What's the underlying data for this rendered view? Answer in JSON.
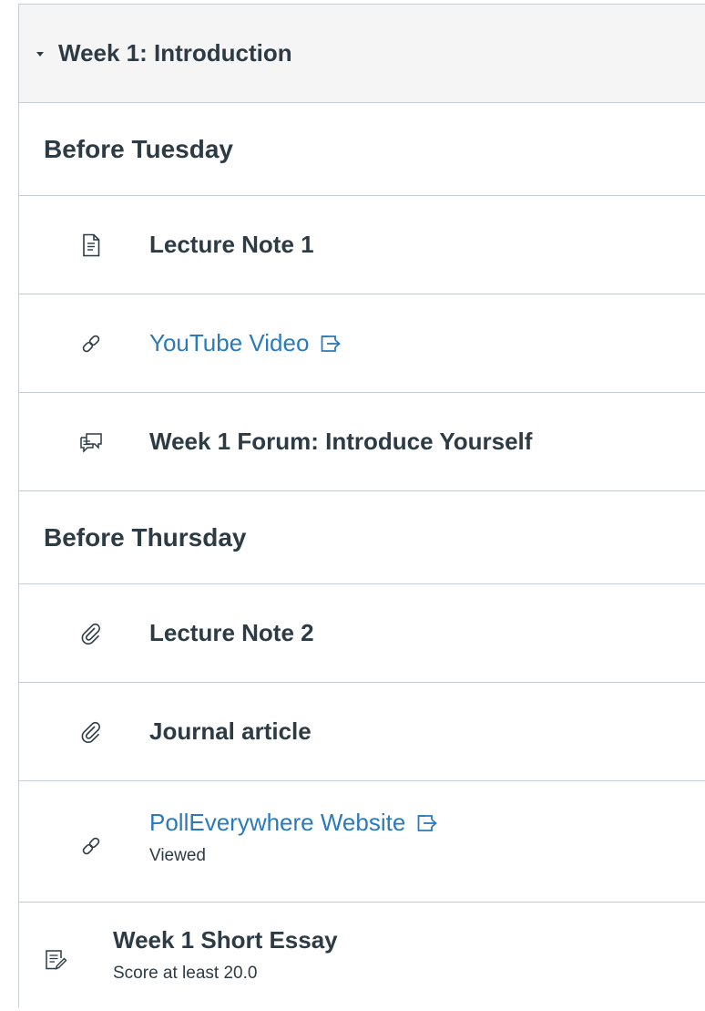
{
  "module": {
    "title": "Week 1: Introduction",
    "sections": [
      {
        "header": "Before Tuesday",
        "items": [
          {
            "title": "Lecture Note 1",
            "icon": "document-icon",
            "link": false
          },
          {
            "title": "YouTube Video",
            "icon": "link-icon",
            "link": true,
            "external": true
          },
          {
            "title": "Week 1 Forum: Introduce Yourself",
            "icon": "discussion-icon",
            "link": false
          }
        ]
      },
      {
        "header": "Before Thursday",
        "items": [
          {
            "title": "Lecture Note 2",
            "icon": "attachment-icon",
            "link": false
          },
          {
            "title": "Journal article",
            "icon": "attachment-icon",
            "link": false
          },
          {
            "title": "PollEverywhere Website",
            "icon": "link-icon",
            "link": true,
            "external": true,
            "meta": "Viewed"
          }
        ]
      }
    ],
    "assignment": {
      "title": "Week 1 Short Essay",
      "icon": "assignment-icon",
      "meta": "Score at least 20.0"
    }
  },
  "colors": {
    "text": "#2d3b45",
    "link": "#2b7abc",
    "border": "#c7cdd1",
    "header_bg": "#f5f5f5"
  }
}
